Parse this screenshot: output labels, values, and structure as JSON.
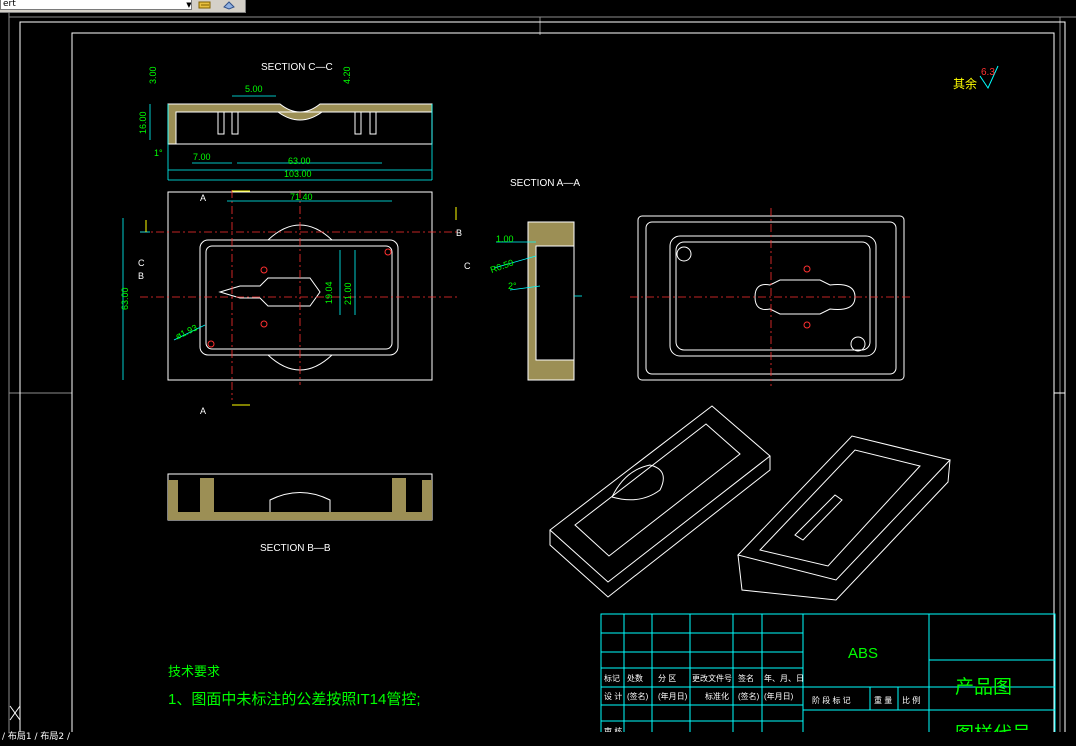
{
  "toolbar": {
    "layer_value": "ert",
    "icons": [
      "layer-states-icon",
      "layer-properties-icon"
    ]
  },
  "statusbar": {
    "text": "/ 布局1 / 布局2 /"
  },
  "drawing": {
    "section_cc": "SECTION C—C",
    "section_aa": "SECTION A—A",
    "section_bb": "SECTION B—B",
    "roughness_prefix": "其余",
    "roughness_value": "6.3",
    "dims_cc": {
      "d300": "3.00",
      "d500": "5.00",
      "d420": "4.20",
      "d1600": "16.00",
      "d700": "7.00",
      "d6300": "63.00",
      "d10300": "103.00",
      "d1deg": "1°"
    },
    "dims_plan": {
      "d7140": "71.40",
      "d6300v": "63.00",
      "d1904": "19.04",
      "d2100": "21.00",
      "r193": "ø1.93"
    },
    "dims_aa": {
      "d100": "1.00",
      "r050": "R0.50",
      "d2deg": "2°"
    },
    "plan_labels": {
      "a_top": "A",
      "a_bottom": "A",
      "b_left": "B",
      "b_right": "B",
      "c_left": "C",
      "c_right": "C"
    },
    "tech_req_title": "技术要求",
    "tech_req_item": "1、图面中未标注的公差按照IT14管控;",
    "title_block": {
      "material": "ABS",
      "drawing_type": "产品图",
      "drawing_number_label": "图样代号",
      "row_marks": [
        "标记",
        "处数",
        "分 区",
        "更改文件号",
        "签名",
        "年、月、日"
      ],
      "row_design": [
        "设 计",
        "(签名)",
        "(年月日)",
        "标准化",
        "(签名)",
        "(年月日)"
      ],
      "row_review": "审 核",
      "stage_row": [
        "阶 段 标 记",
        "重 量",
        "比 例"
      ]
    }
  }
}
